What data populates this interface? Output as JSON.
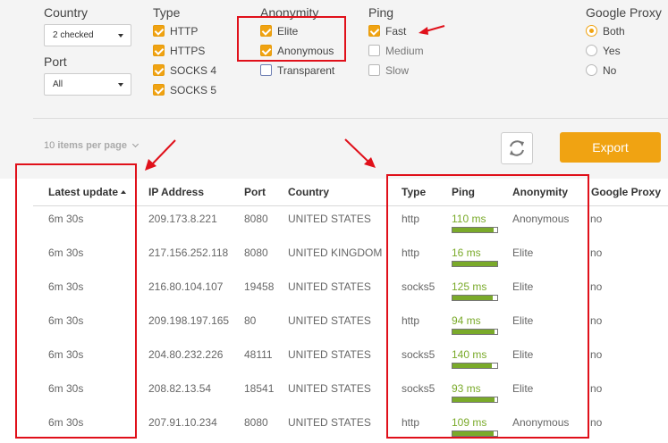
{
  "filters": {
    "country": {
      "title": "Country",
      "selected": "2 checked"
    },
    "port": {
      "title": "Port",
      "selected": "All"
    },
    "type": {
      "title": "Type",
      "options": [
        {
          "label": "HTTP",
          "checked": true
        },
        {
          "label": "HTTPS",
          "checked": true
        },
        {
          "label": "SOCKS 4",
          "checked": true
        },
        {
          "label": "SOCKS 5",
          "checked": true
        }
      ]
    },
    "anonymity": {
      "title": "Anonymity",
      "options": [
        {
          "label": "Elite",
          "checked": true
        },
        {
          "label": "Anonymous",
          "checked": true
        },
        {
          "label": "Transparent",
          "checked": false
        }
      ]
    },
    "ping": {
      "title": "Ping",
      "options": [
        {
          "label": "Fast",
          "checked": true
        },
        {
          "label": "Medium",
          "checked": false
        },
        {
          "label": "Slow",
          "checked": false
        }
      ]
    },
    "google_proxy": {
      "title": "Google Proxy",
      "options": [
        {
          "label": "Both",
          "selected": true
        },
        {
          "label": "Yes",
          "selected": false
        },
        {
          "label": "No",
          "selected": false
        }
      ]
    }
  },
  "toolbar": {
    "per_page_count": "10",
    "per_page_label": "items per page",
    "export_label": "Export",
    "refresh_icon": "refresh-icon"
  },
  "table": {
    "headers": [
      "Latest update",
      "IP Address",
      "Port",
      "Country",
      "Type",
      "Ping",
      "Anonymity",
      "Google Proxy"
    ],
    "rows": [
      {
        "update": "6m 30s",
        "ip": "209.173.8.221",
        "port": "8080",
        "country": "UNITED STATES",
        "type": "http",
        "ping": "110 ms",
        "ping_level": 0.92,
        "anonymity": "Anonymous",
        "google": "no"
      },
      {
        "update": "6m 30s",
        "ip": "217.156.252.118",
        "port": "8080",
        "country": "UNITED KINGDOM",
        "type": "http",
        "ping": "16 ms",
        "ping_level": 0.99,
        "anonymity": "Elite",
        "google": "no"
      },
      {
        "update": "6m 30s",
        "ip": "216.80.104.107",
        "port": "19458",
        "country": "UNITED STATES",
        "type": "socks5",
        "ping": "125 ms",
        "ping_level": 0.9,
        "anonymity": "Elite",
        "google": "no"
      },
      {
        "update": "6m 30s",
        "ip": "209.198.197.165",
        "port": "80",
        "country": "UNITED STATES",
        "type": "http",
        "ping": "94 ms",
        "ping_level": 0.93,
        "anonymity": "Elite",
        "google": "no"
      },
      {
        "update": "6m 30s",
        "ip": "204.80.232.226",
        "port": "48111",
        "country": "UNITED STATES",
        "type": "socks5",
        "ping": "140 ms",
        "ping_level": 0.88,
        "anonymity": "Elite",
        "google": "no"
      },
      {
        "update": "6m 30s",
        "ip": "208.82.13.54",
        "port": "18541",
        "country": "UNITED STATES",
        "type": "socks5",
        "ping": "93 ms",
        "ping_level": 0.93,
        "anonymity": "Elite",
        "google": "no"
      },
      {
        "update": "6m 30s",
        "ip": "207.91.10.234",
        "port": "8080",
        "country": "UNITED STATES",
        "type": "http",
        "ping": "109 ms",
        "ping_level": 0.92,
        "anonymity": "Anonymous",
        "google": "no"
      }
    ]
  },
  "colors": {
    "accent": "#f0a312",
    "ping_green": "#7aaa2a",
    "annotation_red": "#e0101a"
  }
}
